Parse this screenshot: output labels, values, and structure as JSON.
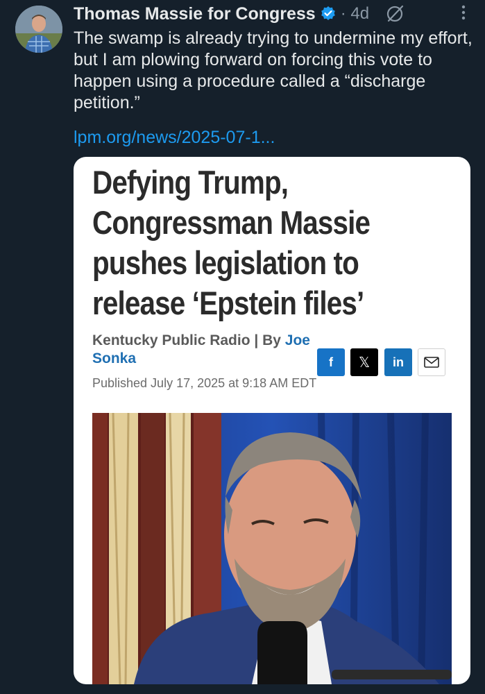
{
  "tweet": {
    "author_name": "Thomas Massie for Congress",
    "time": "· 4d",
    "text": "The swamp is already trying to undermine my effort, but I am plowing forward on forcing this vote to happen using a procedure called a “discharge petition.”",
    "link": "lpm.org/news/2025-07-1...",
    "icons": [
      "verified-badge-icon",
      "grok-icon",
      "more-options-icon"
    ]
  },
  "card": {
    "headline": "Defying Trump, Congressman Massie pushes legislation to release ‘Epstein files’",
    "source": "Kentucky Public Radio | By ",
    "author": "Joe Sonka",
    "published": "Published July 17, 2025 at 9:18 AM EDT",
    "share": {
      "facebook": "f",
      "x": "𝕏",
      "linkedin": "in"
    }
  },
  "colors": {
    "background": "#15202b",
    "link": "#1d9bf0",
    "verified": "#1d9bf0",
    "facebook": "#1773c6",
    "linkedin": "#1771b8"
  }
}
